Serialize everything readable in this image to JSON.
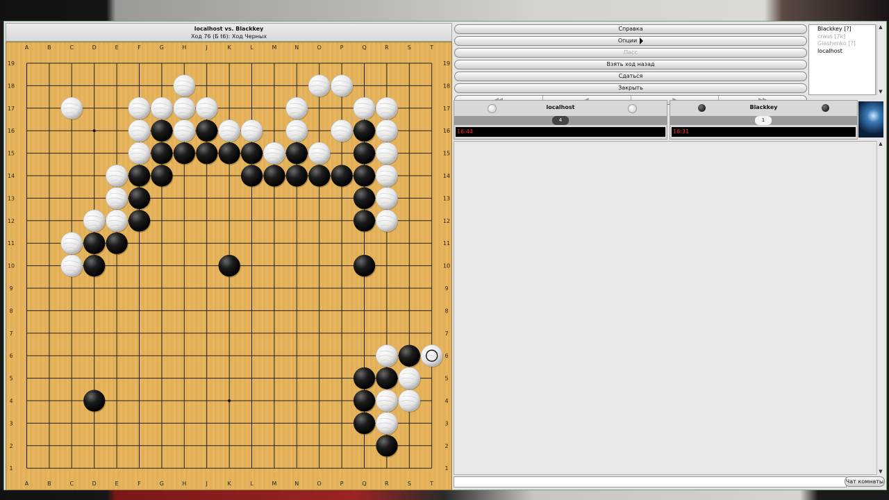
{
  "board_header": {
    "title": "localhost vs. Blackkey",
    "status": "Ход 76 (Б t6): Ход Черных"
  },
  "board": {
    "size": 19,
    "columns": [
      "A",
      "B",
      "C",
      "D",
      "E",
      "F",
      "G",
      "H",
      "J",
      "K",
      "L",
      "M",
      "N",
      "O",
      "P",
      "Q",
      "R",
      "S",
      "T"
    ],
    "rows": [
      "19",
      "18",
      "17",
      "16",
      "15",
      "14",
      "13",
      "12",
      "11",
      "10",
      "9",
      "8",
      "7",
      "6",
      "5",
      "4",
      "3",
      "2",
      "1"
    ],
    "white_stones": [
      "H18",
      "O18",
      "P18",
      "C17",
      "F17",
      "G17",
      "H17",
      "J17",
      "N17",
      "Q17",
      "R17",
      "F16",
      "H16",
      "K16",
      "L16",
      "N16",
      "P16",
      "R16",
      "F15",
      "M15",
      "O15",
      "R15",
      "E14",
      "R14",
      "E13",
      "R13",
      "D12",
      "E12",
      "R12",
      "C11",
      "C10",
      "R6",
      "S5",
      "R4",
      "S4",
      "R3",
      "T6"
    ],
    "black_stones": [
      "G16",
      "J16",
      "Q16",
      "G15",
      "H15",
      "J15",
      "K15",
      "L15",
      "N15",
      "Q15",
      "F14",
      "G14",
      "L14",
      "M14",
      "N14",
      "O14",
      "P14",
      "Q14",
      "F13",
      "Q13",
      "F12",
      "Q12",
      "D11",
      "E11",
      "D10",
      "K10",
      "Q10",
      "S6",
      "Q5",
      "R5",
      "Q4",
      "Q3",
      "R2",
      "D4"
    ],
    "last_move": "T6",
    "hoshi": [
      "D16",
      "D4",
      "K4"
    ],
    "colors": {
      "board": "#e4b25a",
      "line": "#222222"
    }
  },
  "controls": {
    "help": "Справка",
    "options": "Опции",
    "pass": "Пасс",
    "undo": "Взять ход назад",
    "resign": "Сдаться",
    "close": "Закрыть",
    "nav": [
      "◀◀",
      "◀",
      "▶",
      "▶▶"
    ]
  },
  "players_list": [
    {
      "name": "Blackkey [?]",
      "dim": false
    },
    {
      "name": "craus [7k]",
      "dim": true
    },
    {
      "name": "Glashenko [?]",
      "dim": true
    },
    {
      "name": "localhost",
      "dim": false
    }
  ],
  "white_player": {
    "name": "localhost",
    "captures": "4",
    "time": "16:44"
  },
  "black_player": {
    "name": "Blackkey",
    "captures": "1",
    "time": "16:31"
  },
  "chat": {
    "button": "Чат комнаты",
    "input_value": ""
  }
}
